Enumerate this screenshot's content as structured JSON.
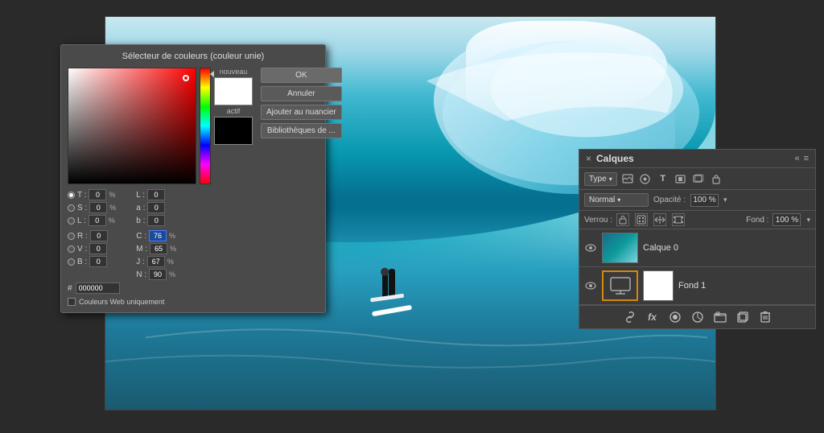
{
  "app": {
    "bg_color": "#2a2a2a"
  },
  "color_picker": {
    "title": "Sélecteur de couleurs (couleur unie)",
    "new_label": "nouveau",
    "active_label": "actif",
    "buttons": {
      "ok": "OK",
      "cancel": "Annuler",
      "add_swatch": "Ajouter au nuancier",
      "libraries": "Bibliothèques de ..."
    },
    "inputs": {
      "T_label": "T :",
      "T_value": "0",
      "S_label": "S :",
      "S_value": "0",
      "L_label": "L :",
      "L_value": "0",
      "R_label": "R :",
      "R_value": "0",
      "V_label": "V :",
      "V_value": "0",
      "B_label": "B :",
      "B_value": "0",
      "Lstar_label": "L :",
      "Lstar_value": "0",
      "a_label": "a :",
      "a_value": "0",
      "b_label": "b :",
      "b_value": "0",
      "C_label": "C :",
      "C_value": "76",
      "M_label": "M :",
      "M_value": "65",
      "J_label": "J :",
      "J_value": "67",
      "N_label": "N :",
      "N_value": "90",
      "pct": "%",
      "hex_label": "#",
      "hex_value": "000000"
    },
    "web_only_label": "Couleurs Web uniquement"
  },
  "layers_panel": {
    "title": "Calques",
    "close_label": "×",
    "menu_icon": "≡",
    "collapse_icon": "«",
    "type_dropdown": "Type",
    "blend_mode": "Normal",
    "opacity_label": "Opacité :",
    "opacity_value": "100 %",
    "verrou_label": "Verrou :",
    "fond_label": "Fond :",
    "fond_value": "100 %",
    "layers": [
      {
        "name": "Calque 0",
        "visible": true,
        "selected": false
      },
      {
        "name": "Fond 1",
        "visible": true,
        "selected": true
      }
    ]
  }
}
